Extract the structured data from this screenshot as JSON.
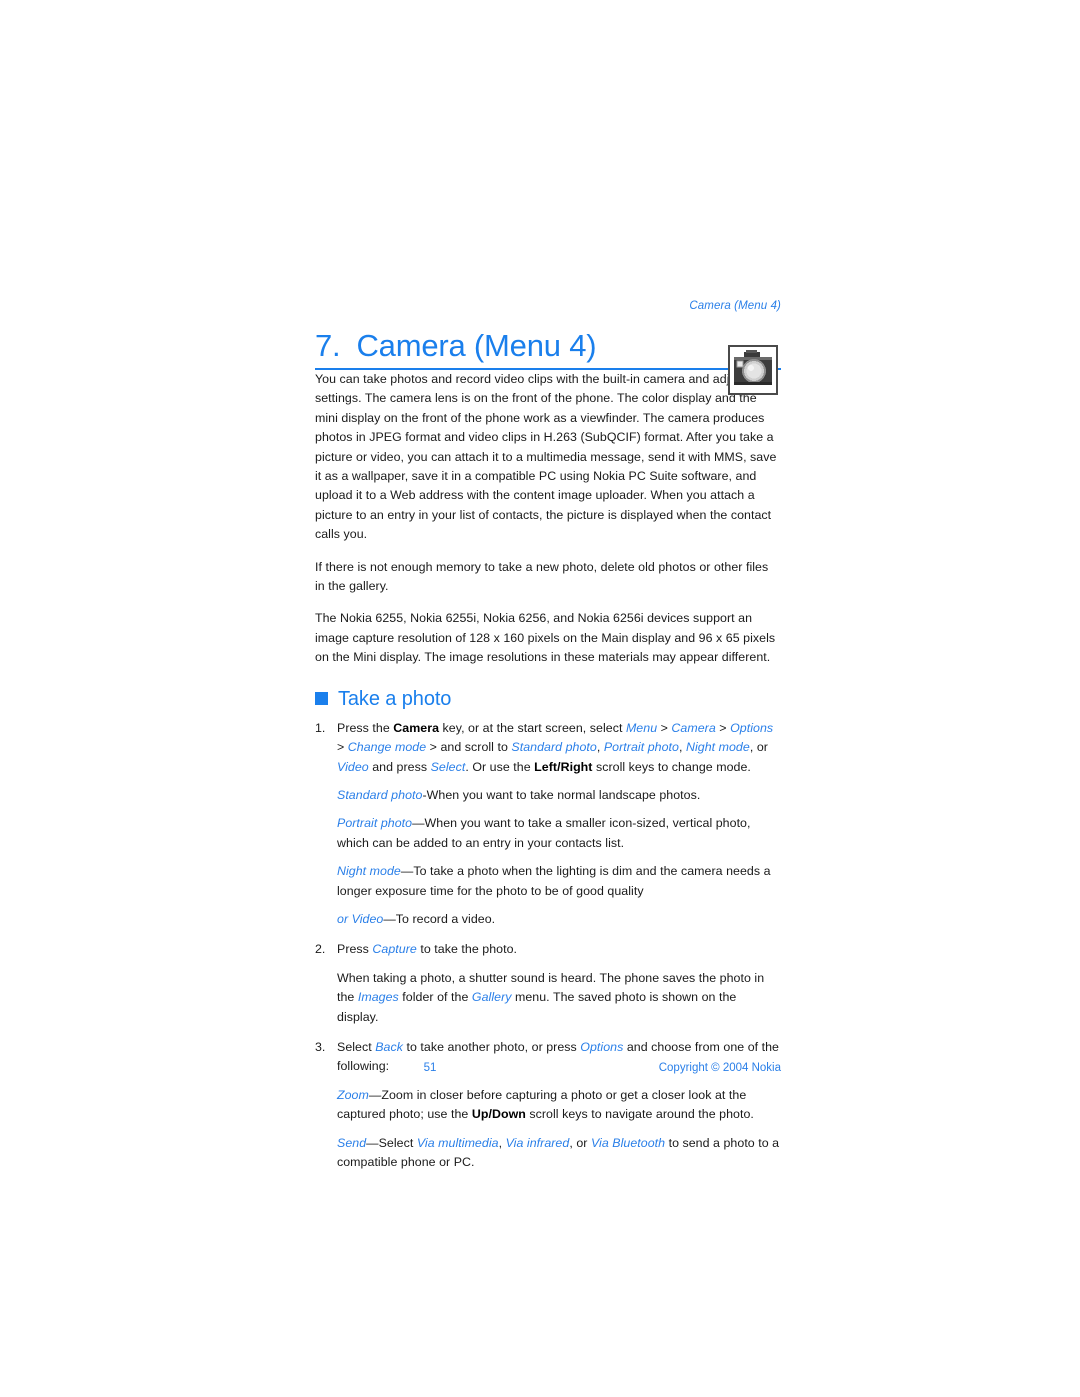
{
  "document": {
    "running_header": "Camera (Menu 4)",
    "chapter_number": "7.",
    "chapter_title": "Camera (Menu 4)",
    "header_icon": "camera-icon"
  },
  "intro": {
    "paragraph_1": "You can take photos and record video clips with the built-in camera and adjust its settings. The camera lens is on the front of the phone. The color display and the mini display on the front of the phone work as a viewfinder. The camera produces photos in JPEG format and video clips in H.263 (SubQCIF) format. After you take a picture or video, you can attach it to a multimedia message, send it with MMS, save it as a wallpaper, save it in a compatible PC using Nokia PC Suite software, and upload it to a Web address with the content image uploader. When you attach a picture to an entry in your list of contacts, the picture is displayed when the contact calls you.",
    "paragraph_2": "If there is not enough memory to take a new photo, delete old photos or other files in the gallery.",
    "paragraph_3": "The Nokia 6255, Nokia 6255i, Nokia 6256, and Nokia 6256i devices support an image capture resolution of 128 x 160 pixels on the Main display and 96 x 65 pixels on the Mini display. The image resolutions in these materials may appear different."
  },
  "section": {
    "heading": "Take a photo",
    "bullet": "square-bullet"
  },
  "steps": {
    "step1": {
      "number": "1.",
      "t1": "Press the ",
      "key1": "Camera",
      "t2": " key, or at the start screen, select ",
      "ui1": "Menu",
      "t3": " > ",
      "ui2": "Camera",
      "t4": " > ",
      "ui3": "Options",
      "t5": " > ",
      "ui4": "Change mode",
      "t6": " > and scroll to ",
      "ui5": "Standard photo",
      "t7": ", ",
      "ui6": "Portrait photo",
      "t8": ", ",
      "ui7": "Night mode",
      "t9": ", or ",
      "ui8": "Video",
      "t10": " and press ",
      "ui9": "Select",
      "t11": ". Or use the ",
      "key2": "Left/Right",
      "t12": " scroll keys to change mode."
    },
    "modes": {
      "standard": {
        "term": "Standard photo",
        "dash": "-",
        "desc": "When you want to take normal landscape photos."
      },
      "portrait": {
        "term": "Portrait photo",
        "dash": "—",
        "desc": "When you want to take a smaller icon-sized, vertical photo, which can be added to an entry in your contacts list."
      },
      "night": {
        "term": "Night mode",
        "dash": "—",
        "desc": "To take a photo when the lighting is dim and the camera needs a longer exposure time for the photo to be of good quality"
      },
      "video": {
        "term": "or Video",
        "dash": "—",
        "desc": "To record a video."
      }
    },
    "step2": {
      "number": "2.",
      "t1": "Press ",
      "ui1": "Capture",
      "t2": " to take the photo.",
      "note_t1": "When taking a photo, a shutter sound is heard. The phone saves the photo in the ",
      "note_ui1": "Images",
      "note_t2": " folder of the ",
      "note_ui2": "Gallery",
      "note_t3": " menu. The saved photo is shown on the display."
    },
    "step3": {
      "number": "3.",
      "t1": "Select ",
      "ui1": "Back",
      "t2": " to take another photo, or press ",
      "ui2": "Options",
      "t3": " and choose from one of the following:",
      "zoom": {
        "term": "Zoom",
        "dash": "—",
        "t1": "Zoom in closer before capturing a photo or get a closer look at the captured photo; use the ",
        "key1": "Up/Down",
        "t2": " scroll keys to navigate around the photo."
      },
      "send": {
        "term": "Send",
        "dash": "—",
        "t1": "Select ",
        "ui1": "Via multimedia",
        "t2": ", ",
        "ui2": "Via infrared",
        "t3": ", or ",
        "ui3": "Via Bluetooth",
        "t4": " to send a photo to a compatible phone or PC."
      }
    }
  },
  "footer": {
    "page_number": "51",
    "copyright": "Copyright © 2004 Nokia"
  },
  "colors": {
    "accent_blue": "#1a7fec",
    "link_blue": "#2a7fe8",
    "text": "#1a1a1a",
    "background": "#ffffff"
  }
}
